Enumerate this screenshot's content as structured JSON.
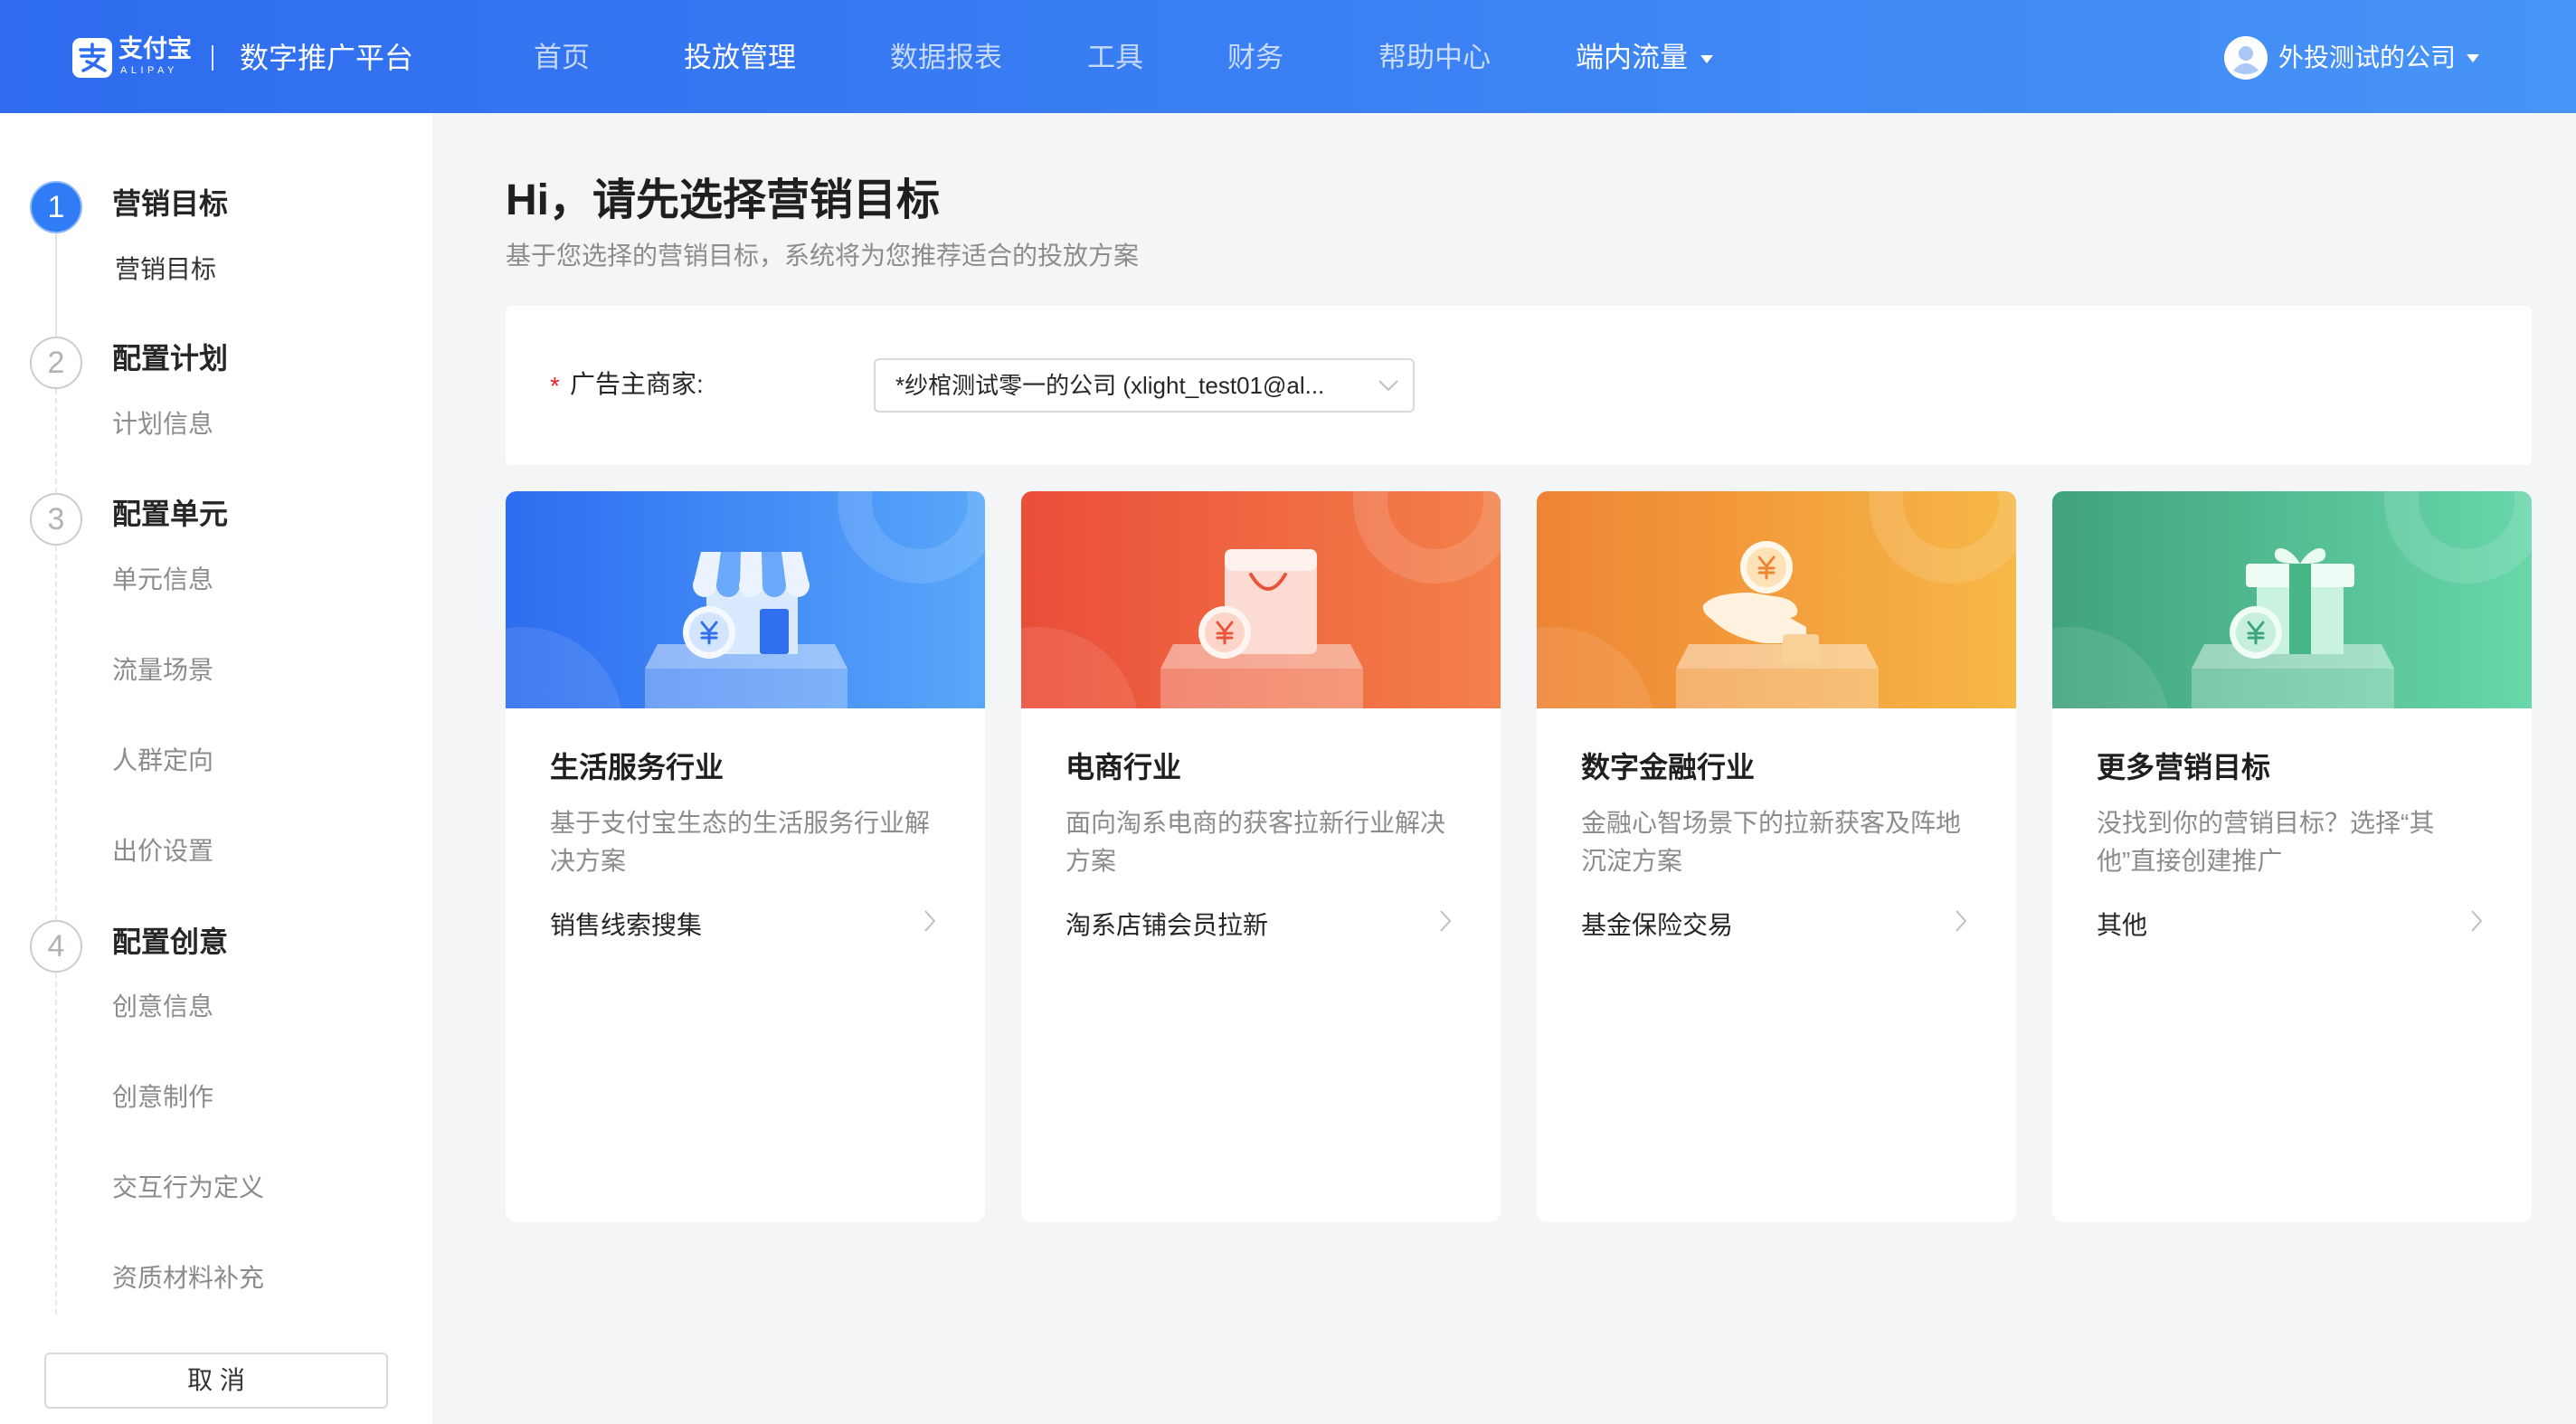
{
  "header": {
    "logo": {
      "cn": "支付宝",
      "en": "ALIPAY",
      "icon": "alipay-logo-icon"
    },
    "platform": "数字推广平台",
    "nav": [
      {
        "label": "首页",
        "active": false
      },
      {
        "label": "投放管理",
        "active": true
      },
      {
        "label": "数据报表",
        "active": false
      },
      {
        "label": "工具",
        "active": false
      },
      {
        "label": "财务",
        "active": false
      },
      {
        "label": "帮助中心",
        "active": false
      }
    ],
    "nav_dropdown": {
      "label": "端内流量",
      "icon": "caret-down-icon"
    },
    "account": {
      "name": "外投测试的公司",
      "avatar_icon": "user-avatar-icon",
      "caret_icon": "caret-down-icon"
    }
  },
  "sidebar": {
    "steps": [
      {
        "number": "1",
        "title": "营销目标",
        "status": "current",
        "items": [
          {
            "label": "营销目标",
            "active": true
          }
        ]
      },
      {
        "number": "2",
        "title": "配置计划",
        "status": "pending",
        "items": [
          {
            "label": "计划信息"
          }
        ]
      },
      {
        "number": "3",
        "title": "配置单元",
        "status": "pending",
        "items": [
          {
            "label": "单元信息"
          },
          {
            "label": "流量场景"
          },
          {
            "label": "人群定向"
          },
          {
            "label": "出价设置"
          }
        ]
      },
      {
        "number": "4",
        "title": "配置创意",
        "status": "pending",
        "items": [
          {
            "label": "创意信息"
          },
          {
            "label": "创意制作"
          },
          {
            "label": "交互行为定义"
          },
          {
            "label": "资质材料补充"
          }
        ]
      }
    ],
    "cancel_label": "取 消"
  },
  "main": {
    "title": "Hi，请先选择营销目标",
    "subtitle": "基于您选择的营销目标，系统将为您推荐适合的投放方案",
    "advertiser": {
      "required_mark": "*",
      "label": "广告主商家:",
      "selected": "*纱棺测试零一的公司 (xlight_test01@al...",
      "icon": "chevron-down-icon"
    },
    "cards": [
      {
        "title": "生活服务行业",
        "description": "基于支付宝生态的生活服务行业解决方案",
        "link": "销售线索搜集",
        "icon": "storefront-icon",
        "gradient": [
          "#2d6cf0",
          "#58a8fa"
        ]
      },
      {
        "title": "电商行业",
        "description": "面向淘系电商的获客拉新行业解决方案",
        "link": "淘系店铺会员拉新",
        "icon": "shopping-bag-icon",
        "gradient": [
          "#ea4d39",
          "#f4814a"
        ]
      },
      {
        "title": "数字金融行业",
        "description": "金融心智场景下的拉新获客及阵地沉淀方案",
        "link": "基金保险交易",
        "icon": "hand-coin-icon",
        "gradient": [
          "#ee8434",
          "#f7b846"
        ]
      },
      {
        "title": "更多营销目标",
        "description": "没找到你的营销目标？选择“其他”直接创建推广",
        "link": "其他",
        "icon": "gift-box-icon",
        "gradient": [
          "#40a37b",
          "#68d7a9"
        ]
      }
    ]
  },
  "colors": {
    "primary": "#2f7cf6",
    "required": "#f5222d",
    "header_gradient": [
      "#2e6bef",
      "#4794f7"
    ]
  }
}
